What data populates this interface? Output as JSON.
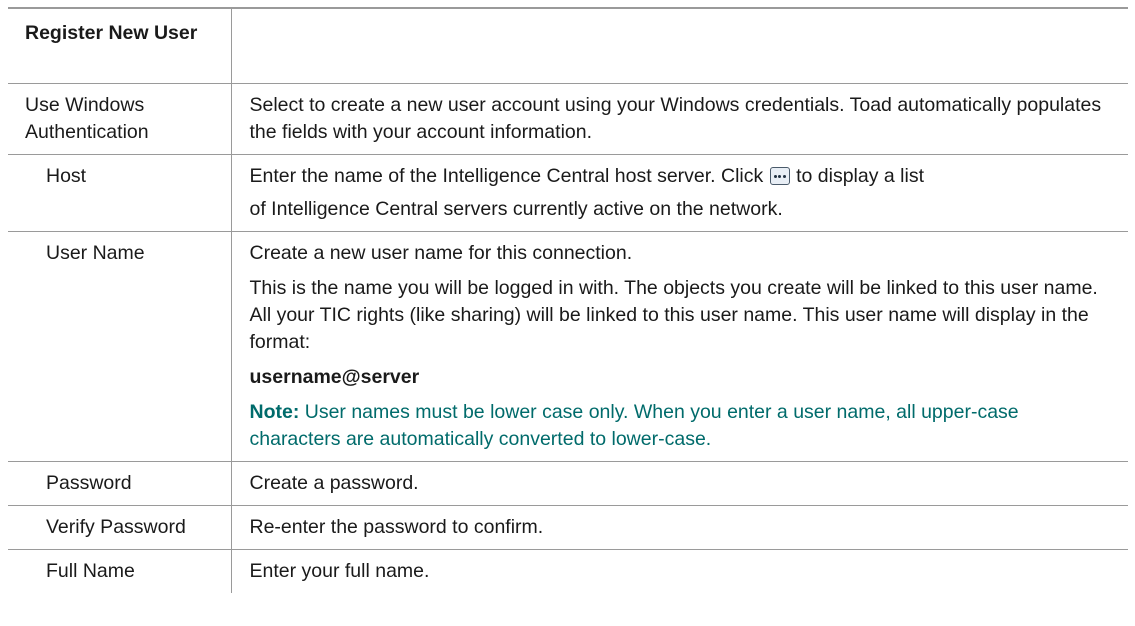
{
  "table": {
    "header": {
      "col1": "Register New User",
      "col2": ""
    },
    "rows": {
      "windows_auth": {
        "label": "Use Windows Authentication",
        "desc": "Select to create a new user account using your Windows credentials. Toad automatically populates the fields with your account information."
      },
      "host": {
        "label": "Host",
        "desc_before_icon": "Enter the name of the Intelligence Central host server. Click",
        "desc_after_icon": "to display a list",
        "desc_line2": "of Intelligence Central servers currently active on the network.",
        "icon": "ellipsis-icon"
      },
      "user_name": {
        "label": "User Name",
        "p1": "Create a new user name for this connection.",
        "p2": "This is the name you will be logged in with. The objects you create will be linked to this user name. All your TIC rights (like sharing) will be linked to this user name. This user name will display in the format:",
        "format": "username@server",
        "note_label": "Note:",
        "note_text": "User names must be lower case only. When you enter a user name, all upper-case characters are automatically converted to lower-case."
      },
      "password": {
        "label": "Password",
        "desc": "Create a password."
      },
      "verify_password": {
        "label": "Verify Password",
        "desc": "Re-enter the password to confirm."
      },
      "full_name": {
        "label": "Full Name",
        "desc": "Enter your full name."
      }
    }
  },
  "colors": {
    "note": "#006b6b",
    "border": "#9a9a9a",
    "text": "#1a1a1a"
  }
}
